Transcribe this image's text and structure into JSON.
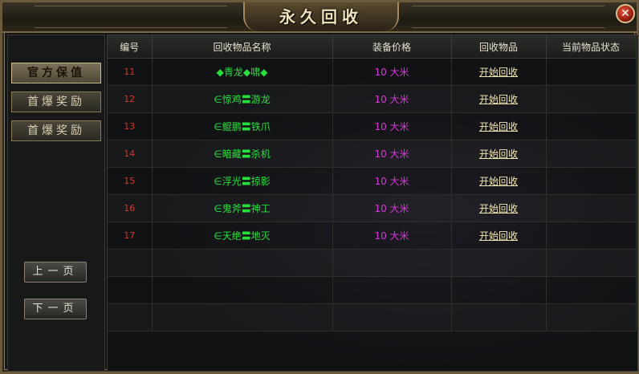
{
  "window": {
    "title": "永久回收",
    "close_glyph": "✕"
  },
  "sidebar": {
    "tabs": [
      {
        "label": "官方保值",
        "active": true
      },
      {
        "label": "首爆奖励",
        "active": false
      },
      {
        "label": "首爆奖励",
        "active": false
      }
    ],
    "prev_page": "上一页",
    "next_page": "下一页"
  },
  "table": {
    "columns": [
      "编号",
      "回收物品名称",
      "装备价格",
      "回收物品",
      "当前物品状态"
    ],
    "rows": [
      {
        "id": "11",
        "name": "◆青龙◆啸◆",
        "price": "10 大米",
        "action": "开始回收",
        "status": ""
      },
      {
        "id": "12",
        "name": "∈惊鸡〓游龙",
        "price": "10 大米",
        "action": "开始回收",
        "status": ""
      },
      {
        "id": "13",
        "name": "∈鲲鹏〓铁爪",
        "price": "10 大米",
        "action": "开始回收",
        "status": ""
      },
      {
        "id": "14",
        "name": "∈暗藏〓杀机",
        "price": "10 大米",
        "action": "开始回收",
        "status": ""
      },
      {
        "id": "15",
        "name": "∈浮光〓掠影",
        "price": "10 大米",
        "action": "开始回收",
        "status": ""
      },
      {
        "id": "16",
        "name": "∈鬼斧〓神工",
        "price": "10 大米",
        "action": "开始回收",
        "status": ""
      },
      {
        "id": "17",
        "name": "∈天绝〓地灭",
        "price": "10 大米",
        "action": "开始回收",
        "status": ""
      },
      {
        "id": "",
        "name": "",
        "price": "",
        "action": "",
        "status": ""
      },
      {
        "id": "",
        "name": "",
        "price": "",
        "action": "",
        "status": ""
      },
      {
        "id": "",
        "name": "",
        "price": "",
        "action": "",
        "status": ""
      }
    ]
  },
  "colors": {
    "id": "#d23b2a",
    "name": "#28e03c",
    "price": "#d43ad6",
    "action": "#f3e7b0"
  }
}
